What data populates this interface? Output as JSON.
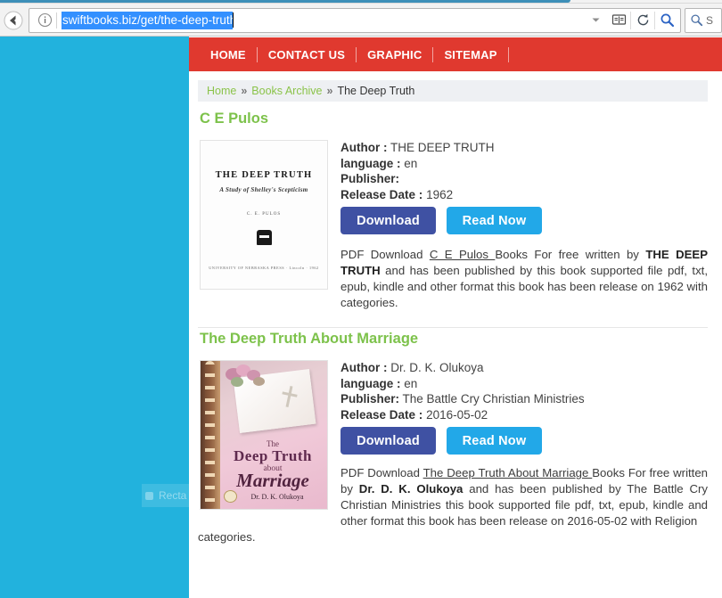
{
  "browser": {
    "url_value": "swiftbooks.biz/get/the-deep-truth",
    "back_icon": "back-arrow-icon",
    "identity_icon": "info-icon",
    "dropdown_icon": "chevron-down-icon",
    "reader_icon": "reader-mode-icon",
    "reload_icon": "reload-icon",
    "urlbar_search_icon": "search-icon",
    "searchbar_icon": "search-icon",
    "search_engine_hint": "S"
  },
  "site": {
    "nav": [
      {
        "label": "HOME"
      },
      {
        "label": "CONTACT US"
      },
      {
        "label": "GRAPHIC"
      },
      {
        "label": "SITEMAP"
      }
    ],
    "breadcrumb": {
      "home": "Home",
      "sep": "»",
      "archive": "Books Archive",
      "current": "The Deep Truth"
    },
    "colors": {
      "nav_red": "#e0392f",
      "left_rail_blue": "#22b2dd",
      "title_green": "#7dc24b",
      "download_blue": "#3f51a3",
      "read_blue": "#22a8e8"
    },
    "books": [
      {
        "title": "C E Pulos",
        "author_label": "Author :",
        "author_value": "THE DEEP TRUTH",
        "language_label": "language :",
        "language_value": "en",
        "publisher_label": "Publisher:",
        "publisher_value": "",
        "release_label": "Release Date :",
        "release_value": "1962",
        "download_label": "Download",
        "read_label": "Read Now",
        "cover": {
          "title": "THE DEEP TRUTH",
          "subtitle": "A Study of Shelley's Scepticism",
          "author": "C. E. PULOS",
          "publisher": "UNIVERSITY OF NEBRASKA PRESS  ·  Lincoln  ·  1962"
        },
        "desc": {
          "p1": "PDF Download ",
          "link": "C E Pulos ",
          "p2": "Books For free written by ",
          "bold": "THE DEEP TRUTH",
          "p3": " and has been published by this book supported file pdf, txt, epub, kindle and other format this book has been release on 1962 with categories."
        }
      },
      {
        "title": "The Deep Truth About Marriage",
        "author_label": "Author :",
        "author_value": "Dr. D. K. Olukoya",
        "language_label": "language :",
        "language_value": "en",
        "publisher_label": "Publisher:",
        "publisher_value": "The Battle Cry Christian Ministries",
        "release_label": "Release Date :",
        "release_value": "2016-05-02",
        "download_label": "Download",
        "read_label": "Read Now",
        "cover": {
          "the": "The",
          "deep_truth": "Deep Truth",
          "about": "about",
          "marriage": "Marriage",
          "author": "Dr. D. K. Olukoya"
        },
        "desc": {
          "p1": "PDF Download ",
          "link": "The Deep Truth About Marriage ",
          "p2": "Books For free written by ",
          "bold": "Dr. D. K. Olukoya",
          "p3": " and has been published by The Battle Cry Christian Ministries this book supported file pdf, txt, epub, kindle and other format this book has been release on 2016-05-02 with Religion",
          "tail": "categories."
        }
      }
    ],
    "sidebar": {
      "search_text": "S",
      "header": "",
      "items": [
        {
          "label": ""
        },
        {
          "label": ""
        },
        {
          "label": ""
        },
        {
          "label": ""
        },
        {
          "label": ""
        },
        {
          "label": ""
        },
        {
          "label": ""
        },
        {
          "label": ""
        },
        {
          "label": ""
        }
      ]
    },
    "ghost_overlay": {
      "label": "Recta"
    }
  }
}
